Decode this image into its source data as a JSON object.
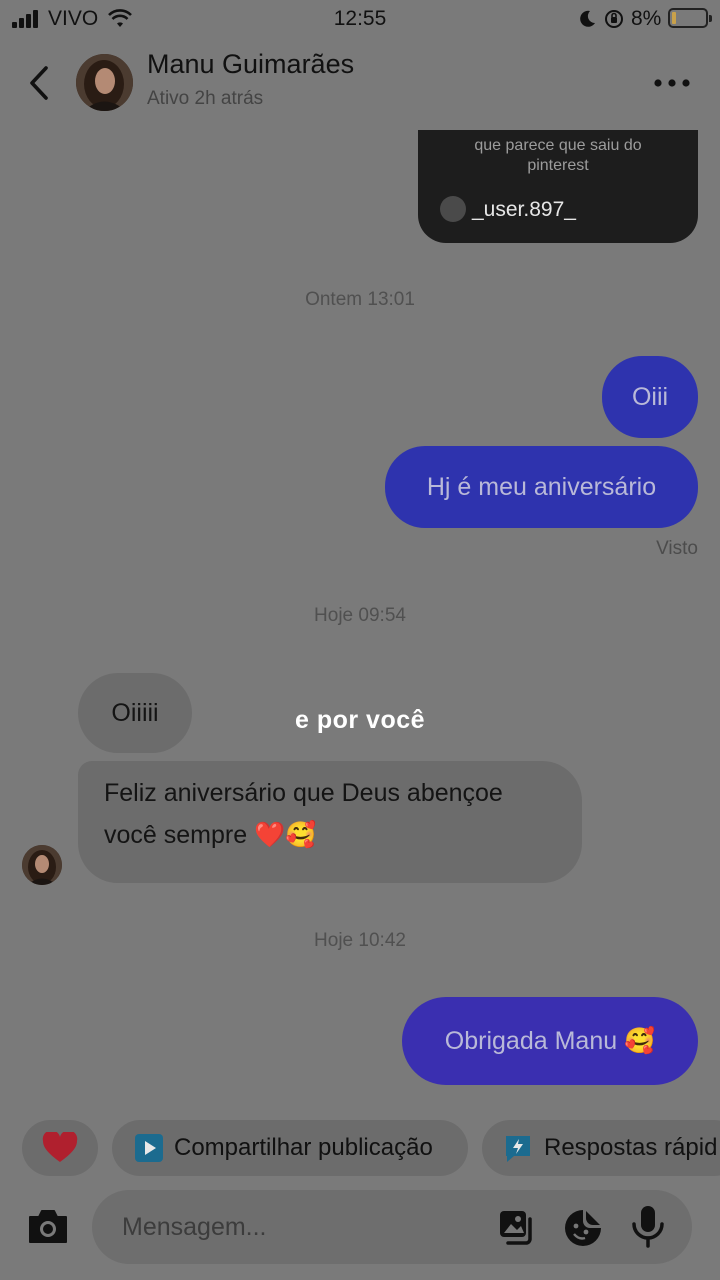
{
  "status_bar": {
    "carrier": "VIVO",
    "time": "12:55",
    "battery_percent": "8%",
    "icons": [
      "signal-icon",
      "wifi-icon",
      "moon-icon",
      "orientation-lock-icon",
      "battery-icon"
    ]
  },
  "header": {
    "contact_name": "Manu Guimarães",
    "status": "Ativo 2h atrás"
  },
  "shared_post": {
    "caption_line1": "que parece que saiu do",
    "caption_line2": "pinterest",
    "username": "_user.897_"
  },
  "messages": {
    "ts1": "Ontem 13:01",
    "out1": "Oiii",
    "out2": "Hj é meu aniversário",
    "seen": "Visto",
    "ts2": "Hoje 09:54",
    "in1": "Oiiiii",
    "in2_line1": "Feliz aniversário que Deus abençoe",
    "in2_line2": "você sempre ❤️🥰",
    "ts3": "Hoje 10:42",
    "out3": "Obrigada Manu 🥰"
  },
  "overlay_text": "e por você",
  "quick_actions": {
    "share_post": "Compartilhar publicação",
    "quick_replies": "Respostas rápid"
  },
  "composer": {
    "placeholder": "Mensagem..."
  },
  "colors": {
    "outgoing_bubble": "#2e33ae",
    "incoming_bubble": "#6c6c6c",
    "background": "#7a7a7a",
    "heart": "#b0202e"
  }
}
